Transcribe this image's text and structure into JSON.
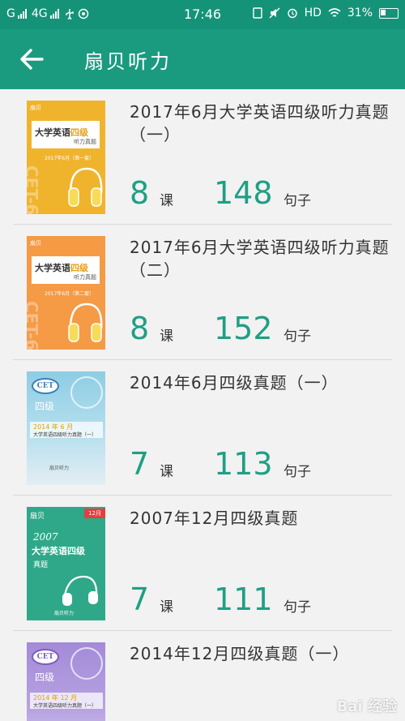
{
  "status": {
    "carrier1": "G",
    "carrier2": "4G",
    "time": "17:46",
    "hd": "HD",
    "battery": "31%"
  },
  "header": {
    "title": "扇贝听力"
  },
  "items": [
    {
      "title": "2017年6月大学英语四级听力真题（一）",
      "lessons": "8",
      "lessons_unit": "课",
      "sentences": "148",
      "sentences_unit": "句子",
      "cover": {
        "badge": "扇贝",
        "main_a": "大学英语",
        "main_b": "四级",
        "sub": "听力真题",
        "date": "2017年6月（第一套）",
        "side": "CET-6",
        "color": "#f0b32c"
      }
    },
    {
      "title": "2017年6月大学英语四级听力真题（二）",
      "lessons": "8",
      "lessons_unit": "课",
      "sentences": "152",
      "sentences_unit": "句子",
      "cover": {
        "badge": "扇贝",
        "main_a": "大学英语",
        "main_b": "四级",
        "sub": "听力真题",
        "date": "2017年6月（第二套）",
        "side": "CET-6",
        "color": "#f59a45"
      }
    },
    {
      "title": "2014年6月四级真题（一）",
      "lessons": "7",
      "lessons_unit": "课",
      "sentences": "113",
      "sentences_unit": "句子",
      "cover": {
        "cet": "CET",
        "level": "四级",
        "year": "2014 年 6 月",
        "strip_title": "大学英语四级听力真题（一）",
        "logo": "扇贝听力",
        "color": "#9fd3e6"
      }
    },
    {
      "title": "2007年12月四级真题",
      "lessons": "7",
      "lessons_unit": "课",
      "sentences": "111",
      "sentences_unit": "句子",
      "cover": {
        "badge": "扇贝",
        "tag": "12月",
        "year": "2007",
        "main": "大学英语四级",
        "sub": "真题",
        "logo": "扇贝听力",
        "color": "#2fa889"
      }
    },
    {
      "title": "2014年12月四级真题（一）",
      "cover": {
        "cet": "CET",
        "level": "四级",
        "year": "2014 年 12 月",
        "strip_title": "大学英语四级听力真题（一）",
        "color": "#a990d8"
      }
    }
  ],
  "watermark": "Bai 经验",
  "colors": {
    "status_bar": "#159378",
    "app_bar": "#1a9b80",
    "accent_number": "#1f9f84",
    "background": "#f2f2f2"
  },
  "icons": {
    "back": "back-arrow-icon",
    "usb": "usb-icon",
    "alarm": "alarm-icon",
    "wifi": "wifi-icon",
    "battery": "battery-icon"
  }
}
